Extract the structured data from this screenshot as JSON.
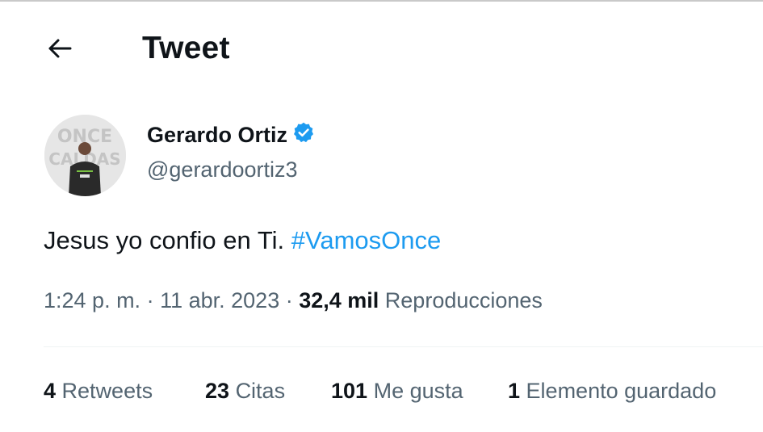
{
  "header": {
    "title": "Tweet",
    "back_icon": "arrow-left-icon"
  },
  "author": {
    "name": "Gerardo Ortiz",
    "handle": "@gerardoortiz3",
    "verified_icon": "verified-badge-icon",
    "verified_color": "#1d9bf0"
  },
  "tweet": {
    "text": "Jesus yo confio en Ti. ",
    "hashtag": "#VamosOnce"
  },
  "meta": {
    "time": "1:24 p. m.",
    "separator": " · ",
    "date": "11 abr. 2023",
    "views_count": "32,4 mil",
    "views_label": "Reproducciones"
  },
  "stats": {
    "retweets_count": "4",
    "retweets_label": "Retweets",
    "quotes_count": "23",
    "quotes_label": "Citas",
    "likes_count": "101",
    "likes_label": "Me gusta",
    "bookmarks_count": "1",
    "bookmarks_label": "Elemento guardado"
  },
  "colors": {
    "link": "#1d9bf0",
    "text": "#0f1419",
    "secondary": "#536471"
  }
}
